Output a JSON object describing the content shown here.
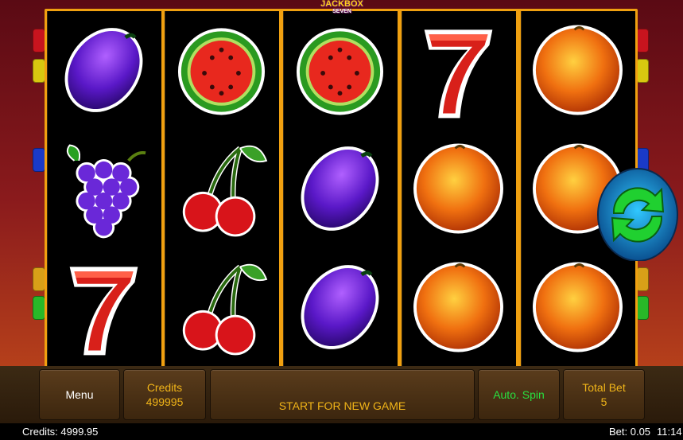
{
  "logo": {
    "line1": "JACKBOX",
    "line2": "SEVEN"
  },
  "reels": [
    [
      "plum-icon",
      "grapes-icon",
      "seven-icon"
    ],
    [
      "watermelon-icon",
      "cherries-icon",
      "cherries-icon"
    ],
    [
      "watermelon-icon",
      "plum-icon",
      "plum-icon"
    ],
    [
      "seven-icon",
      "orange-icon",
      "orange-icon"
    ],
    [
      "orange-icon",
      "orange-icon",
      "orange-icon"
    ]
  ],
  "buttons": {
    "menu": "Menu",
    "credits_label": "Credits",
    "credits_value": "499995",
    "start": "START FOR NEW GAME",
    "autospin": "Auto. Spin",
    "totalbet_label": "Total Bet",
    "totalbet_value": "5"
  },
  "status": {
    "credits": "Credits: 4999.95",
    "bet": "Bet: 0.05",
    "time": "11:14"
  },
  "colors": {
    "frame": "#f0a010",
    "button_text": "#f0b418",
    "autospin_text": "#28e040"
  }
}
